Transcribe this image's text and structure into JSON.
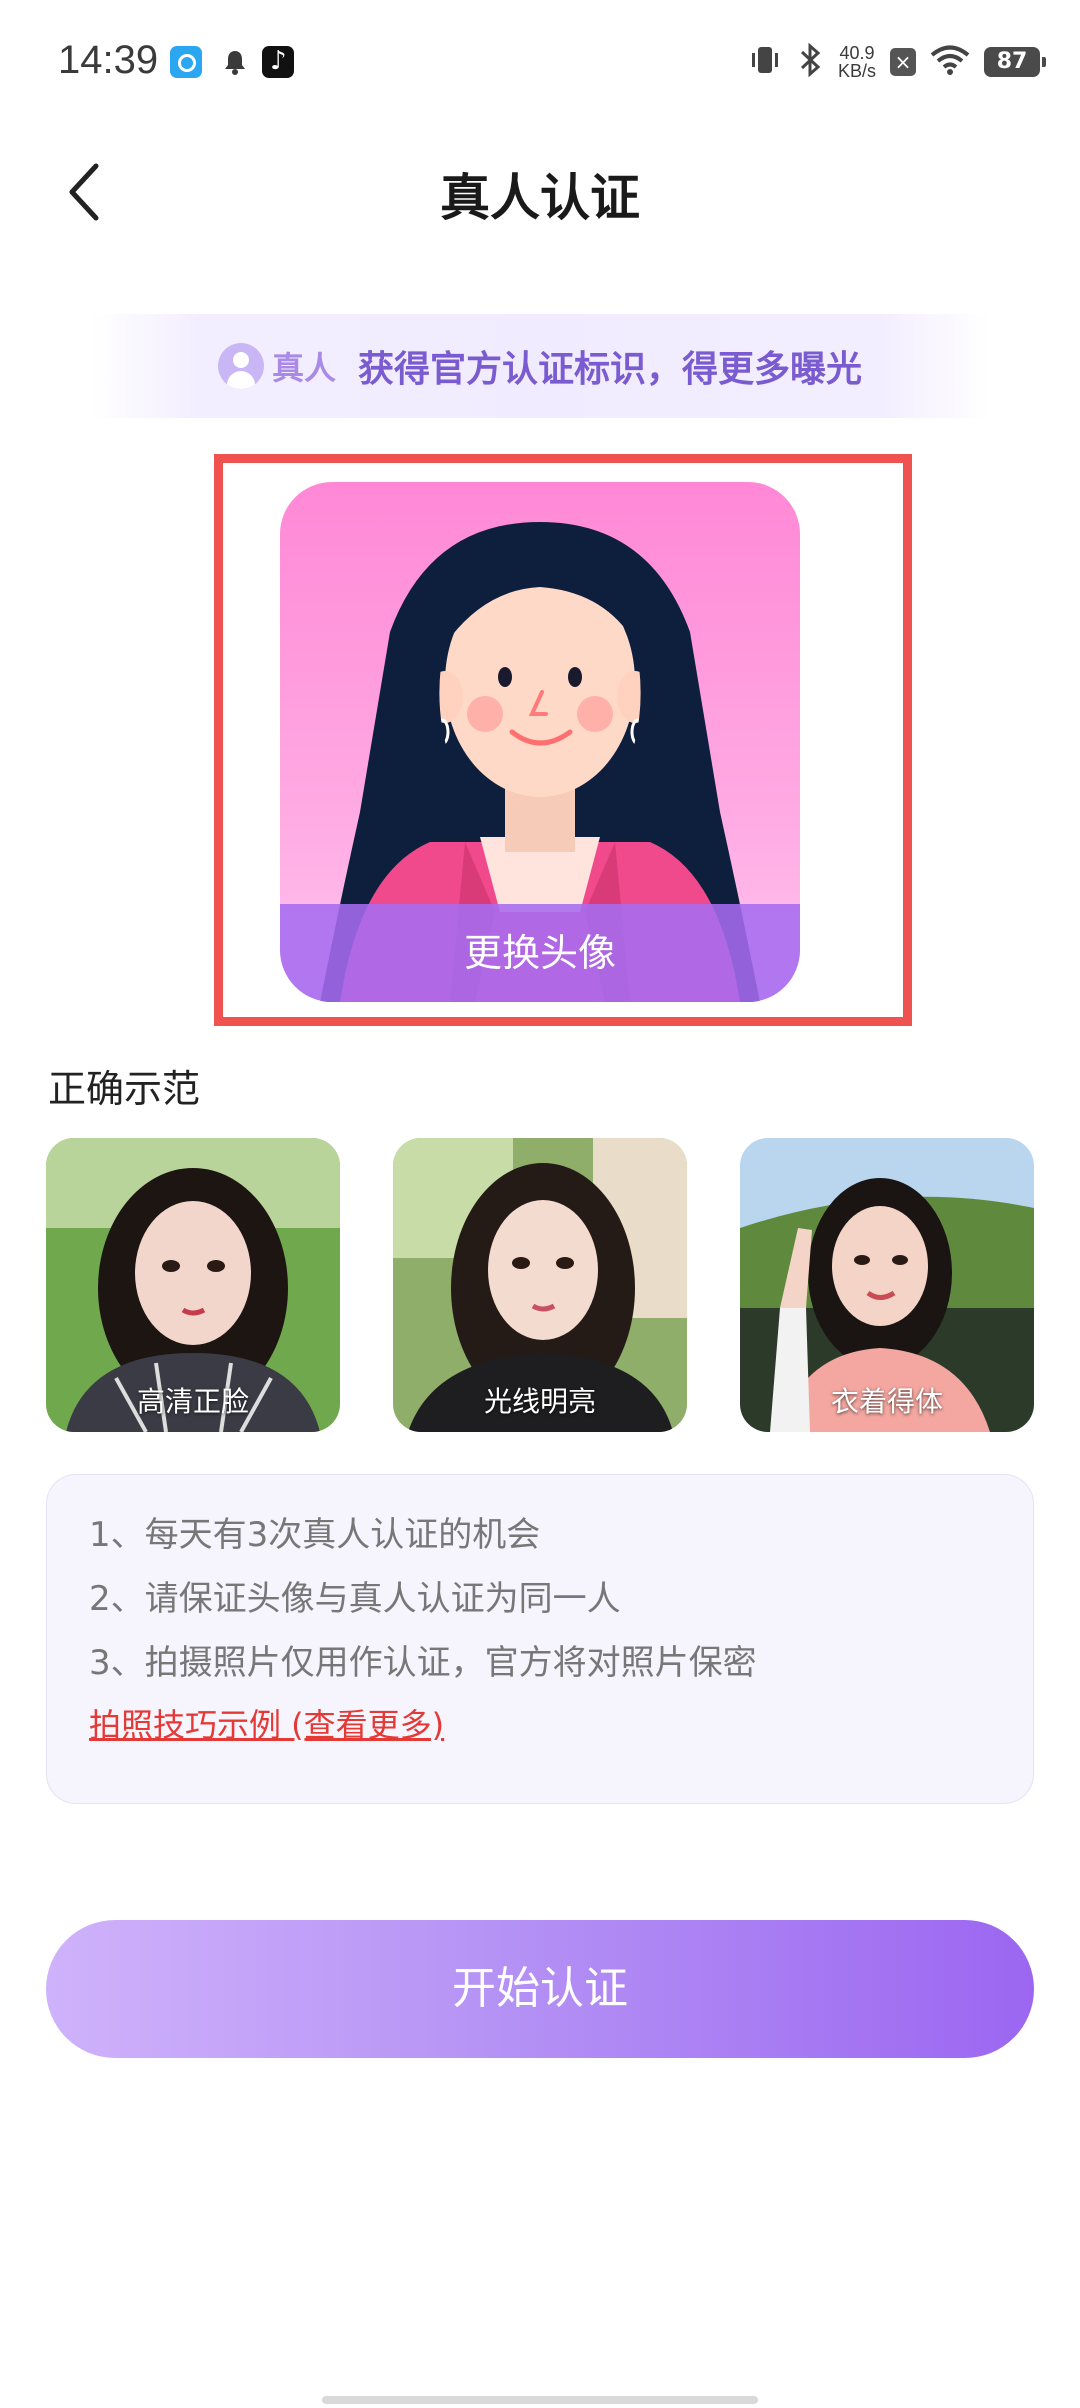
{
  "status_bar": {
    "time": "14:39",
    "net_speed_value": "40.9",
    "net_speed_unit": "KB/s",
    "battery": "87",
    "icons": [
      "app-notification-icon",
      "bell-icon",
      "tiktok-icon",
      "vibrate-icon",
      "bluetooth-icon",
      "sim-icon",
      "wifi-icon",
      "battery-icon"
    ]
  },
  "header": {
    "title": "真人认证",
    "back_icon": "chevron-left-icon"
  },
  "banner": {
    "badge_label": "真人",
    "text": "获得官方认证标识，得更多曝光"
  },
  "avatar": {
    "change_label": "更换头像"
  },
  "examples": {
    "section_title": "正确示范",
    "items": [
      {
        "label": "高清正脸"
      },
      {
        "label": "光线明亮"
      },
      {
        "label": "衣着得体"
      }
    ]
  },
  "info": {
    "lines": [
      "1、每天有3次真人认证的机会",
      "2、请保证头像与真人认证为同一人",
      "3、拍摄照片仅用作认证，官方将对照片保密"
    ],
    "link": "拍照技巧示例 (查看更多)"
  },
  "start_button": {
    "label": "开始认证"
  },
  "colors": {
    "accent": "#9c66f1",
    "highlight_border": "#ef5350",
    "link": "#e53935"
  }
}
